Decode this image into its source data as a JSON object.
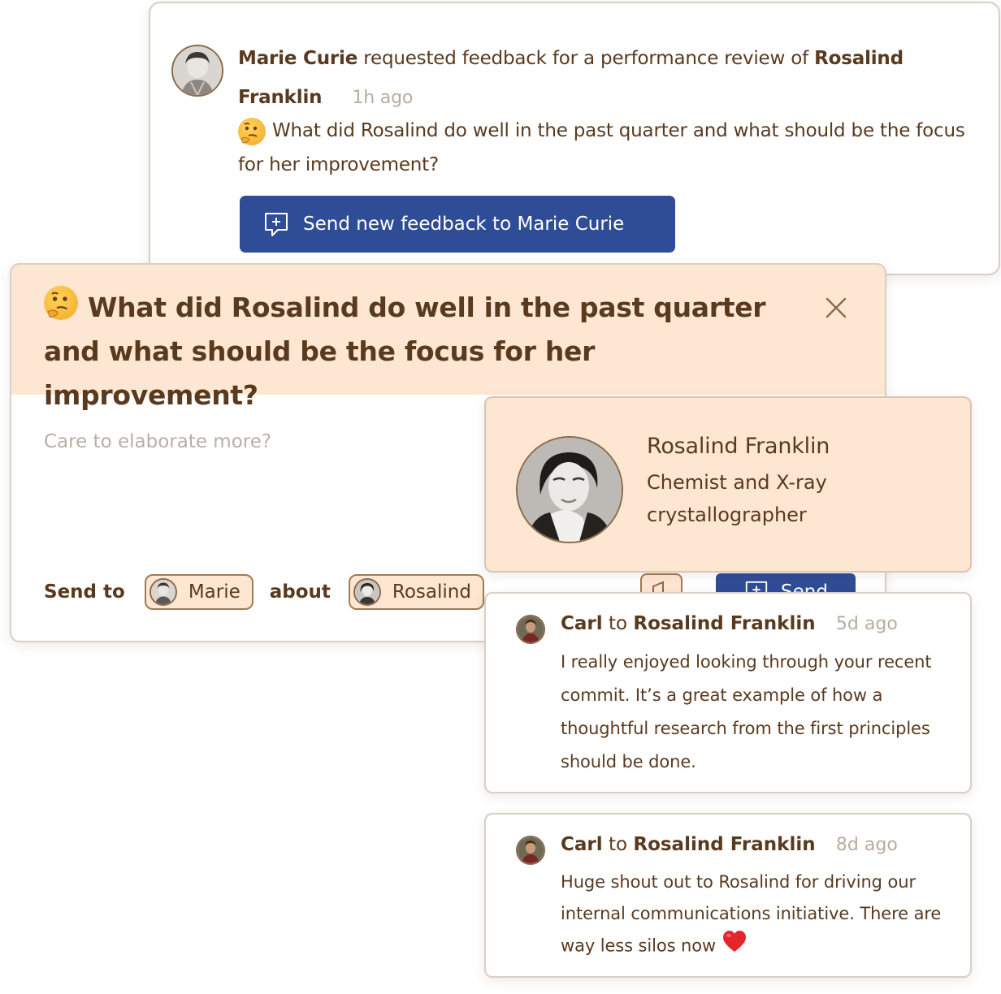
{
  "colors": {
    "text": "#5a3a1e",
    "muted": "#b8aca0",
    "accent_blue": "#2f4c96",
    "peach": "#fde6d2",
    "border": "#d8cfc6"
  },
  "request": {
    "requester": "Marie Curie",
    "action": "requested feedback for a performance review of",
    "subject": "Rosalind Franklin",
    "time": "1h ago",
    "question_emoji": "thinking-face-icon",
    "question": "What did Rosalind do well in the past quarter and what should be the focus for her improvement?",
    "button_label": "Send new feedback to Marie Curie"
  },
  "compose": {
    "title": "What did Rosalind do well in the past quarter and what should be the focus for her improvement?",
    "placeholder": "Care to elaborate more?",
    "send_to_label": "Send to",
    "recipient": "Marie",
    "about_label": "about",
    "about_person": "Rosalind",
    "send_label": "Send"
  },
  "profile": {
    "name": "Rosalind Franklin",
    "title": "Chemist and X-ray crystallographer"
  },
  "feedback": [
    {
      "author": "Carl",
      "to_word": "to",
      "recipient": "Rosalind Franklin",
      "time": "5d ago",
      "body": "I really enjoyed looking through your recent commit. It’s a great example of how a thoughtful research from the first principles should be done."
    },
    {
      "author": "Carl",
      "to_word": "to",
      "recipient": "Rosalind Franklin",
      "time": "8d ago",
      "body": "Huge shout out to Rosalind for driving our internal communications initiative. There are way less silos now"
    }
  ]
}
